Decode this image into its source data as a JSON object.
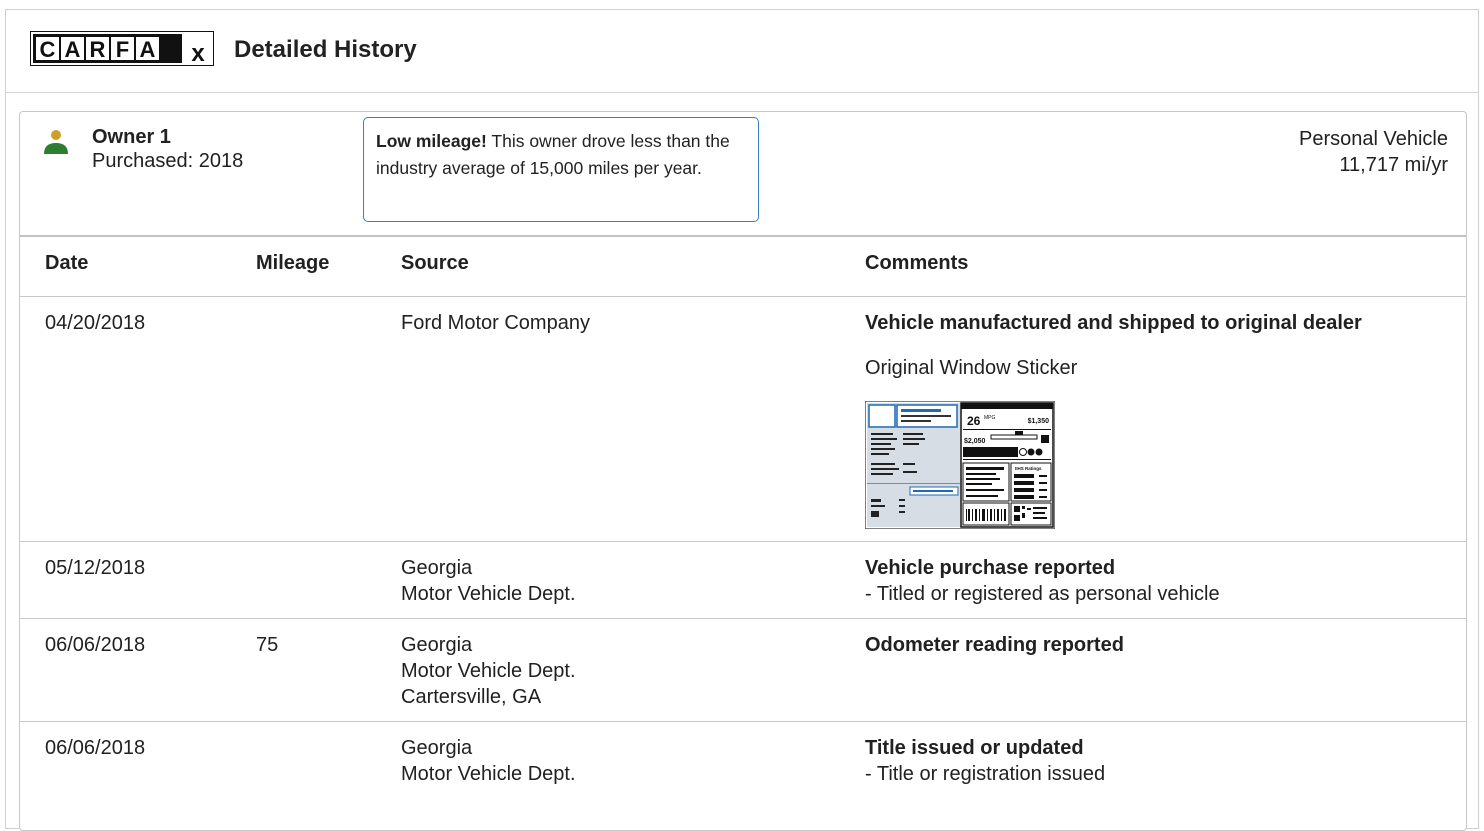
{
  "header": {
    "logo_text": "CARFAX",
    "title": "Detailed History"
  },
  "owner": {
    "name": "Owner 1",
    "purchased": "Purchased: 2018",
    "notice_bold": "Low mileage!",
    "notice_text": " This owner drove less than the industry average of 15,000 miles per year.",
    "usage_type": "Personal Vehicle",
    "usage_miles": "11,717 mi/yr"
  },
  "columns": {
    "date": "Date",
    "mileage": "Mileage",
    "source": "Source",
    "comments": "Comments"
  },
  "rows": [
    {
      "date": "04/20/2018",
      "mileage": "",
      "source": "Ford Motor Company",
      "comment_title": "Vehicle manufactured and shipped to original dealer",
      "comment_sub": "Original Window Sticker"
    },
    {
      "date": "05/12/2018",
      "mileage": "",
      "source_line1": "Georgia",
      "source_line2": "Motor Vehicle Dept.",
      "comment_title": "Vehicle purchase reported",
      "comment_sub": "- Titled or registered as personal vehicle"
    },
    {
      "date": "06/06/2018",
      "mileage": "75",
      "source_line1": "Georgia",
      "source_line2": "Motor Vehicle Dept.",
      "source_line3": "Cartersville, GA",
      "comment_title": "Odometer reading reported"
    },
    {
      "date": "06/06/2018",
      "mileage": "",
      "source_line1": "Georgia",
      "source_line2": "Motor Vehicle Dept.",
      "comment_title": "Title issued or updated",
      "comment_sub": "- Title or registration issued"
    }
  ],
  "sticker": {
    "mpg": "26",
    "mpg_unit": "MPG",
    "save": "$1,350",
    "cost": "$2,050",
    "ratings": "IIHS Ratings"
  },
  "colors": {
    "accent_blue": "#3d7fc4",
    "owner_head": "#c9a227",
    "owner_body": "#2e7d32"
  }
}
